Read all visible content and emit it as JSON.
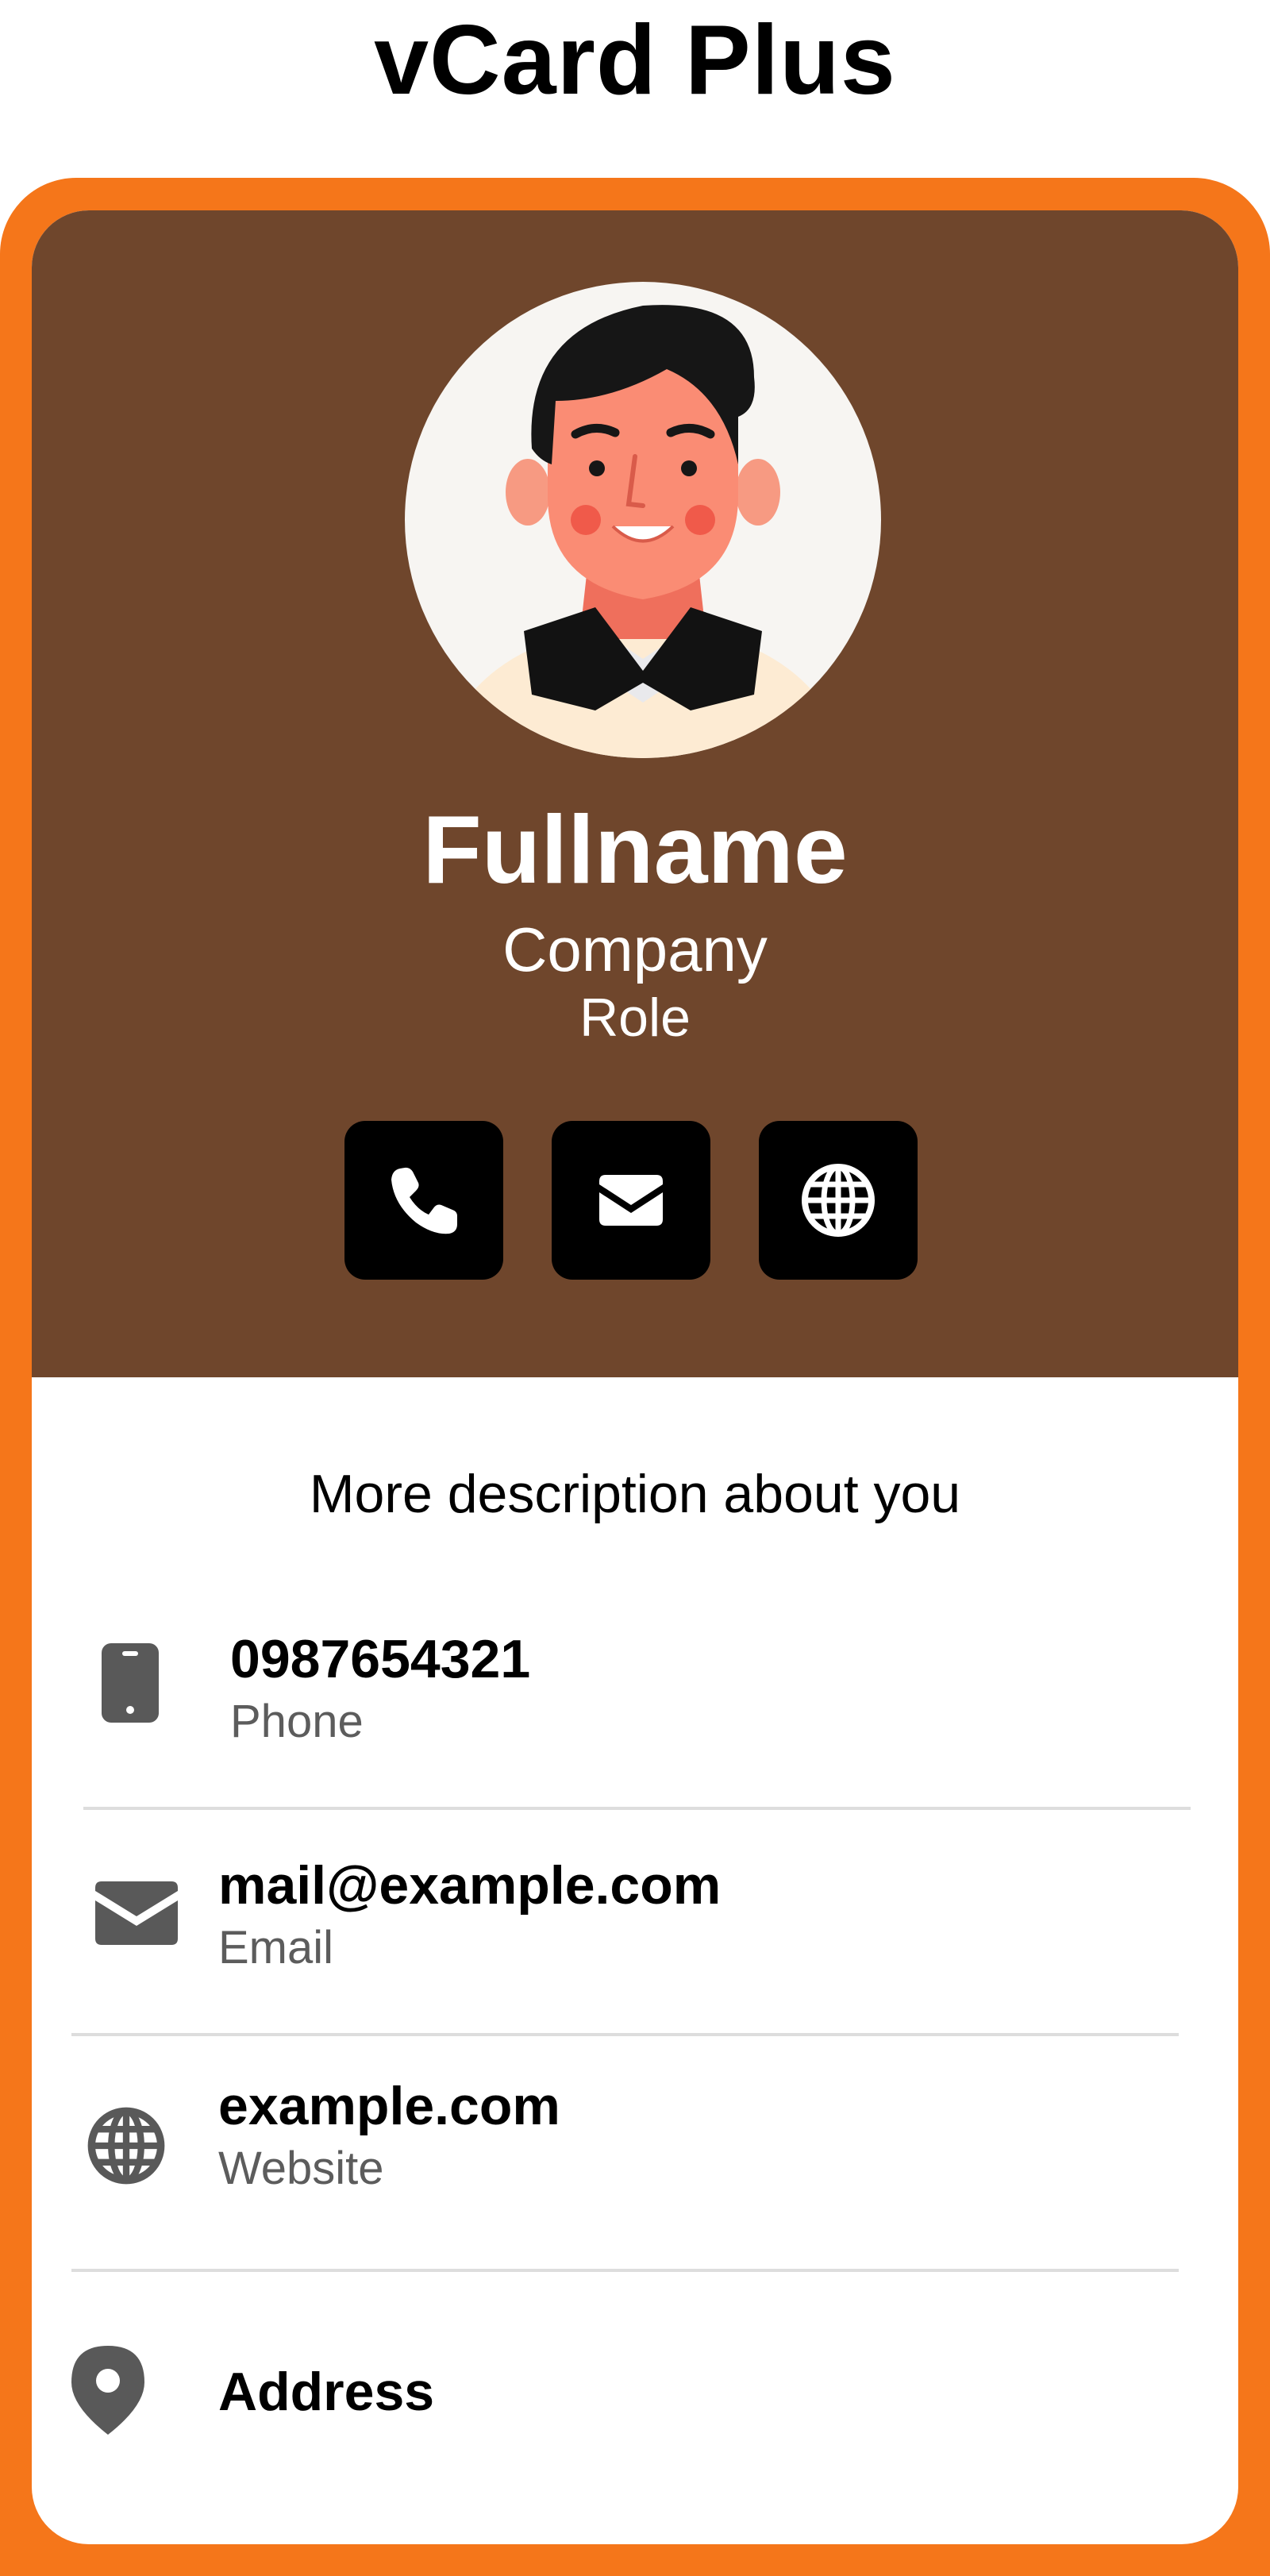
{
  "app": {
    "title": "vCard Plus"
  },
  "colors": {
    "frame": "#f5761a",
    "header_bg": "#6f462c",
    "action_bg": "#000000",
    "icon_gray": "#595959"
  },
  "profile": {
    "fullname": "Fullname",
    "company": "Company",
    "role": "Role"
  },
  "quick_actions": [
    {
      "icon": "phone-icon"
    },
    {
      "icon": "email-icon"
    },
    {
      "icon": "globe-icon"
    }
  ],
  "description": "More description about you",
  "contacts": {
    "phone": {
      "value": "0987654321",
      "label": "Phone",
      "icon": "mobile-phone-icon"
    },
    "email": {
      "value": "mail@example.com",
      "label": "Email",
      "icon": "email-icon"
    },
    "website": {
      "value": "example.com",
      "label": "Website",
      "icon": "globe-icon"
    },
    "address": {
      "value": "Address",
      "icon": "location-pin-icon"
    }
  }
}
